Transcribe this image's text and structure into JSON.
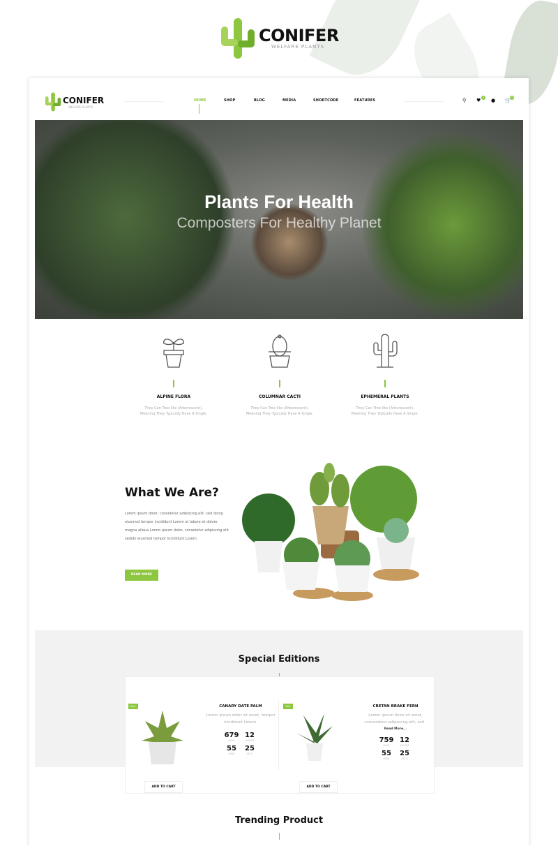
{
  "brand": {
    "name": "CONIFER",
    "tagline": "WELFARE PLANTS",
    "accent": "#8dc63f"
  },
  "nav": {
    "items": [
      "HOME",
      "SHOP",
      "BLOG",
      "MEDIA",
      "SHORTCODE",
      "FEATURES"
    ],
    "active": "HOME",
    "wishlist_count": "0",
    "cart_count": "0"
  },
  "hero": {
    "title": "Plants For Health",
    "subtitle": "Composters For Healthy Planet"
  },
  "features": [
    {
      "icon": "plant-pot-icon",
      "title": "ALPINE FLORA",
      "desc1": "They Can Tree-like (Arborescent),",
      "desc2": "Meaning They Typically Have A Single."
    },
    {
      "icon": "cactus-pot-icon",
      "title": "COLUMNAR CACTI",
      "desc1": "They Can Tree-like (Arborescent),",
      "desc2": "Meaning They Typically Have A Single."
    },
    {
      "icon": "cactus-icon",
      "title": "EPHEMERAL PLANTS",
      "desc1": "They Can Tree-like (Arborescent),",
      "desc2": "Meaning They Typically Have A Single."
    }
  ],
  "about": {
    "title": "What We Are?",
    "text": "Lorem ipsum dolor, consetetur adipiscing elit, sed doing eiusmod tempor incididunt Lorem ut labore et dolore magna aliqua Lorem ipsum dolor, consetetur adipiscing elit sedido eiusmod tempor incididunt Lorem.",
    "button": "READ MORE"
  },
  "special": {
    "title": "Special Editions",
    "products": [
      {
        "badge": "Sale",
        "name": "CANARY DATE PALM",
        "desc": "Lorem ipsum dolor sit amet,  tempor incididunt  labore.",
        "read_more": "",
        "days": "679",
        "hours": "12",
        "mins": "55",
        "secs": "25",
        "button": "ADD TO CART"
      },
      {
        "badge": "Sale",
        "name": "CRETAN BRAKE FERN",
        "desc": "Lorem ipsum dolor sit amet, consectetur adipiscing elit, sed .",
        "read_more": "Read More...",
        "days": "759",
        "hours": "12",
        "mins": "55",
        "secs": "25",
        "button": "ADD TO CART"
      }
    ],
    "labels": {
      "days": "DAYS",
      "hours": "HOURS",
      "mins": "MINS",
      "secs": "SECS"
    }
  },
  "trending": {
    "title": "Trending Product"
  }
}
